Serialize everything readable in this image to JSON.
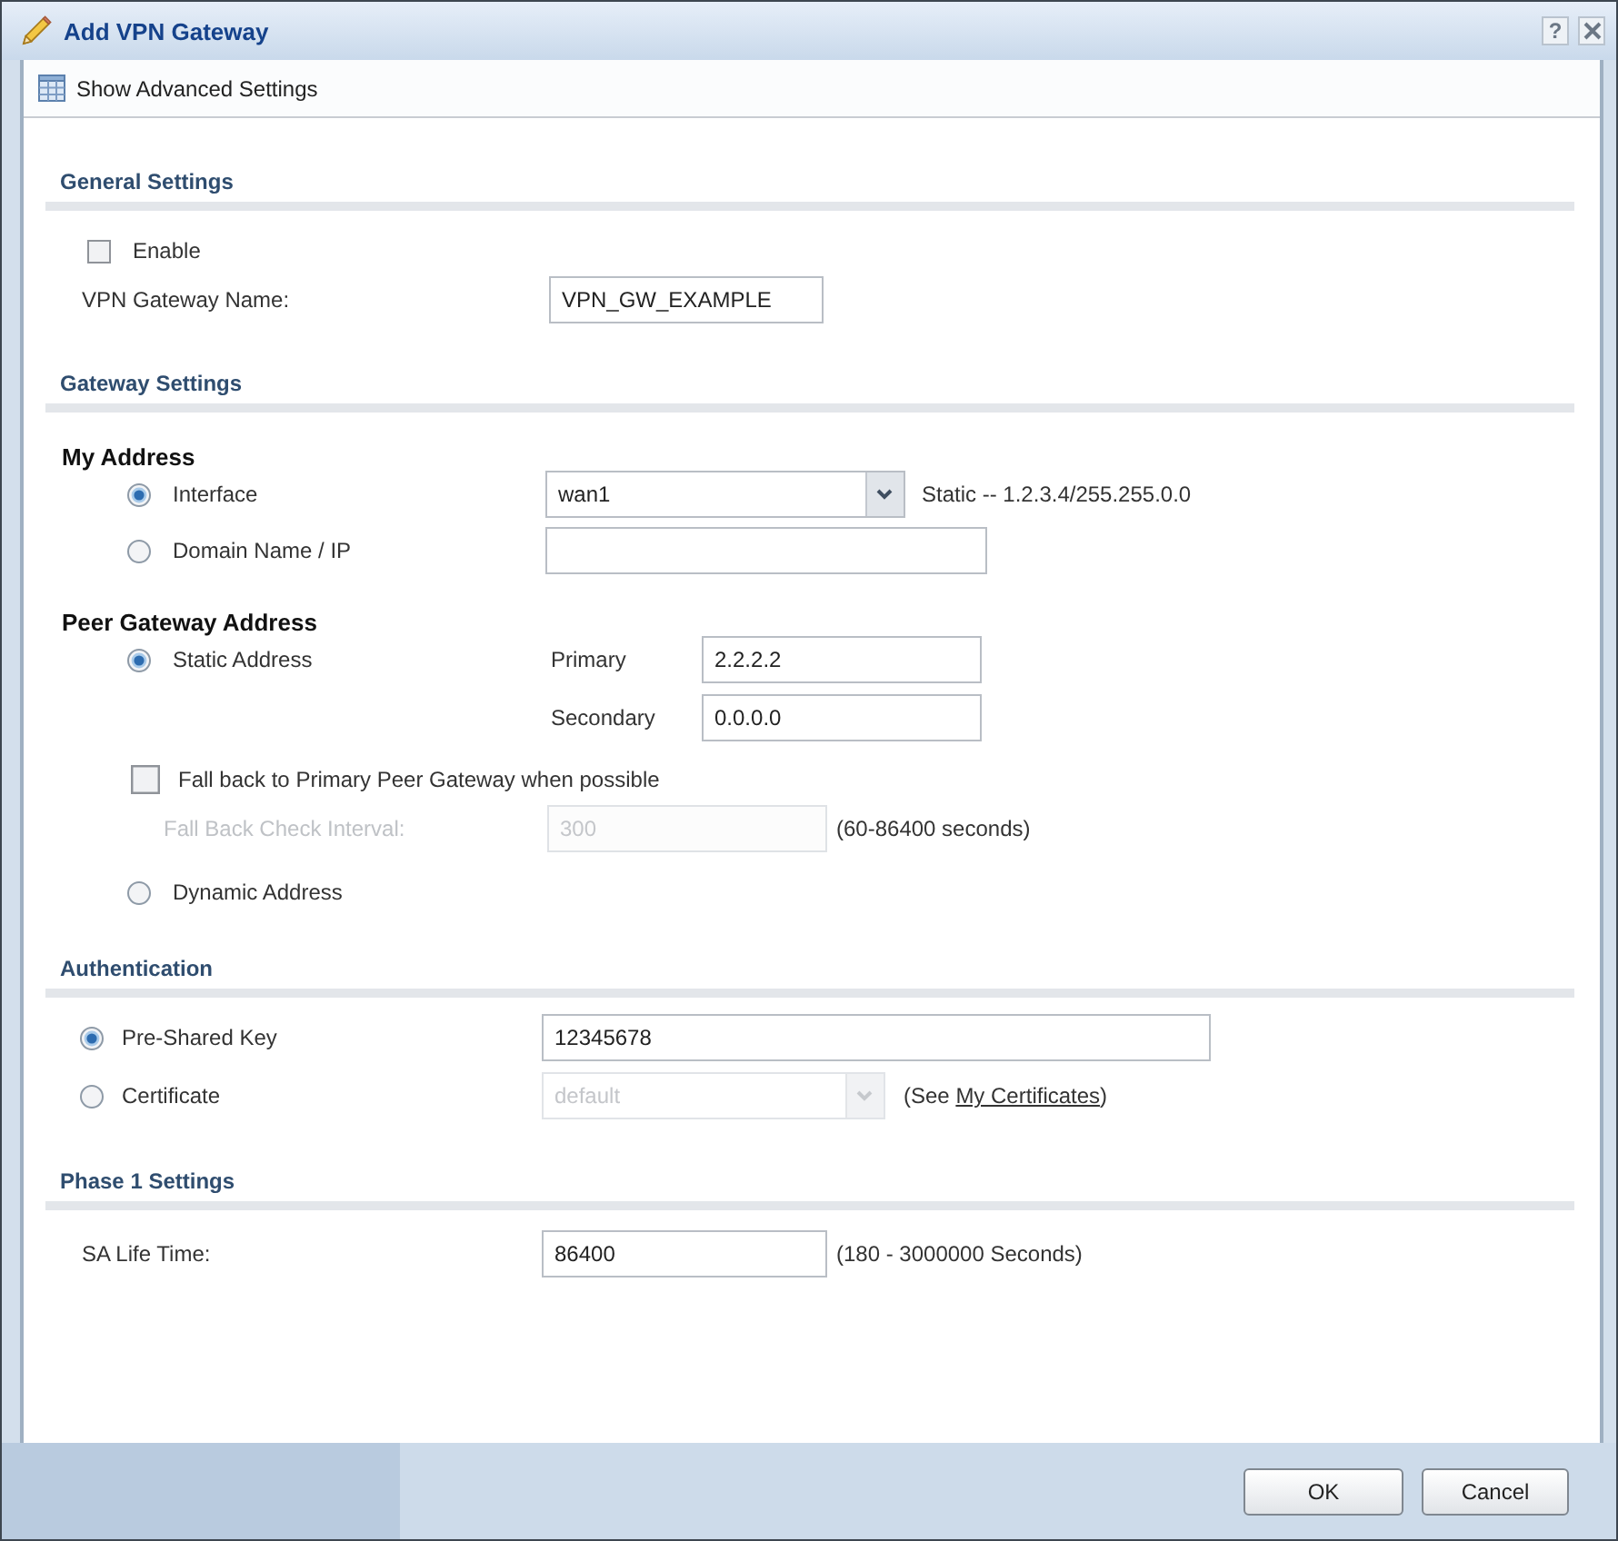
{
  "window": {
    "title": "Add VPN Gateway",
    "help_label": "?"
  },
  "toolbar": {
    "label": "Show Advanced Settings"
  },
  "general_settings": {
    "title": "General Settings",
    "enable": {
      "label": "Enable",
      "checked": false
    },
    "gateway_name": {
      "label": "VPN Gateway Name:",
      "value": "VPN_GW_EXAMPLE"
    }
  },
  "gateway_settings": {
    "title": "Gateway Settings",
    "my_address": {
      "title": "My Address",
      "options": [
        {
          "kind": "select",
          "label": "Interface",
          "selected": true,
          "value": "wan1",
          "note": "Static -- 1.2.3.4/255.255.0.0"
        },
        {
          "kind": "text",
          "label": "Domain Name / IP",
          "selected": false
        }
      ]
    },
    "peer_gateway_address": {
      "title": "Peer Gateway Address",
      "static_address": {
        "label": "Static Address",
        "selected": true,
        "primary": {
          "label": "Primary",
          "value": "2.2.2.2"
        },
        "secondary": {
          "label": "Secondary",
          "value": "0.0.0.0"
        }
      },
      "fall_back": {
        "label": "Fall back to Primary Peer Gateway when possible",
        "checked": false
      },
      "check_interval": {
        "label": "Fall Back Check Interval:",
        "value": "300",
        "note": "(60-86400 seconds)",
        "disabled": true
      },
      "dynamic_address": {
        "label": "Dynamic Address",
        "selected": false
      }
    }
  },
  "authentication": {
    "title": "Authentication",
    "options": [
      {
        "kind": "text",
        "label": "Pre-Shared Key",
        "selected": true,
        "value": "12345678"
      },
      {
        "kind": "select",
        "label": "Certificate",
        "selected": false,
        "value": "default",
        "disabled": true,
        "note_before": "(See ",
        "note_link": "My Certificates",
        "note_after": ")"
      }
    ]
  },
  "phase1_settings": {
    "title": "Phase 1 Settings",
    "sa_life_time": {
      "label": "SA Life Time:",
      "value": "86400",
      "note": "(180 - 3000000 Seconds)"
    }
  },
  "footer": {
    "buttons": [
      "OK",
      "Cancel"
    ]
  }
}
